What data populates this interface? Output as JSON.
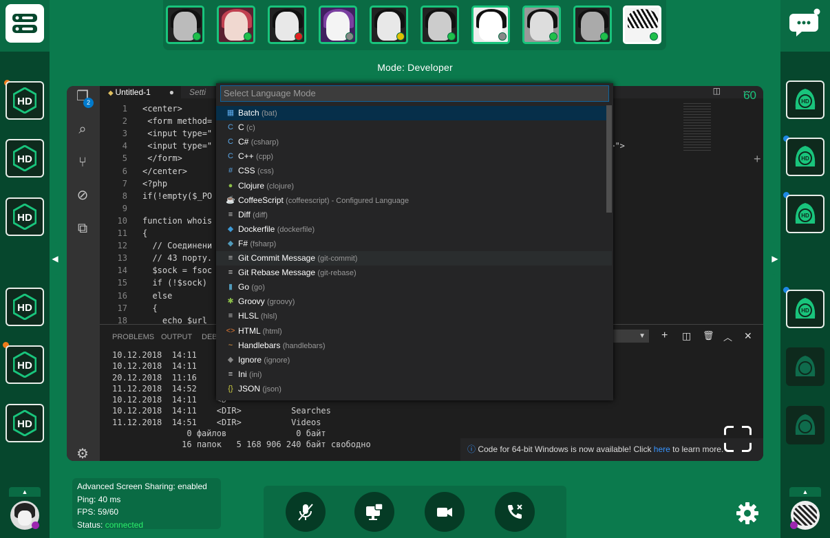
{
  "colors": {
    "accent": "#19c47c",
    "panel": "#0a6b44",
    "sidebar": "#06472d"
  },
  "mode_label": "Mode: Developer",
  "participants": [
    {
      "status": "#1fbf4a"
    },
    {
      "status": "#1fbf4a"
    },
    {
      "status": "#e02020"
    },
    {
      "status": "#888888"
    },
    {
      "status": "#e0c000"
    },
    {
      "status": "#1fbf4a"
    },
    {
      "status": "#888888"
    },
    {
      "status": "#1fbf4a"
    },
    {
      "status": "#1fbf4a"
    },
    {
      "status": "#1fbf4a"
    }
  ],
  "editor": {
    "tab_active": "Untitled-1",
    "tab_other": "Setti",
    "explorer_badge": "2",
    "fps_overlay": "60",
    "code_lines": [
      {
        "n": "1",
        "t": "<center>"
      },
      {
        "n": "2",
        "t": " <form method="
      },
      {
        "n": "3",
        "t": " <input type=\""
      },
      {
        "n": "4",
        "t": " <input type=\""
      },
      {
        "n": "5",
        "t": " </form>"
      },
      {
        "n": "6",
        "t": "</center>"
      },
      {
        "n": "7",
        "t": "<?php"
      },
      {
        "n": "8",
        "t": "if(!empty($_PO"
      },
      {
        "n": "9",
        "t": ""
      },
      {
        "n": "10",
        "t": "function whois"
      },
      {
        "n": "11",
        "t": "{"
      },
      {
        "n": "12",
        "t": "  // Соединени"
      },
      {
        "n": "13",
        "t": "  // 43 порту."
      },
      {
        "n": "14",
        "t": "  $sock = fsoc"
      },
      {
        "n": "15",
        "t": "  if (!$sock)"
      },
      {
        "n": "16",
        "t": "  else"
      },
      {
        "n": "17",
        "t": "  {"
      },
      {
        "n": "18",
        "t": "    echo $url"
      }
    ],
    "code_right_fragment": "?>\">",
    "language_picker": {
      "placeholder": "Select Language Mode",
      "items": [
        {
          "icon": "▦",
          "name": "Batch",
          "id": "(bat)"
        },
        {
          "icon": "C",
          "name": "C",
          "id": "(c)"
        },
        {
          "icon": "C",
          "name": "C#",
          "id": "(csharp)"
        },
        {
          "icon": "C",
          "name": "C++",
          "id": "(cpp)"
        },
        {
          "icon": "#",
          "name": "CSS",
          "id": "(css)"
        },
        {
          "icon": "●",
          "name": "Clojure",
          "id": "(clojure)"
        },
        {
          "icon": "☕",
          "name": "CoffeeScript",
          "id": "(coffeescript) - Configured Language"
        },
        {
          "icon": "≡",
          "name": "Diff",
          "id": "(diff)"
        },
        {
          "icon": "◆",
          "name": "Dockerfile",
          "id": "(dockerfile)"
        },
        {
          "icon": "◆",
          "name": "F#",
          "id": "(fsharp)"
        },
        {
          "icon": "≡",
          "name": "Git Commit Message",
          "id": "(git-commit)"
        },
        {
          "icon": "≡",
          "name": "Git Rebase Message",
          "id": "(git-rebase)"
        },
        {
          "icon": "▮",
          "name": "Go",
          "id": "(go)"
        },
        {
          "icon": "✱",
          "name": "Groovy",
          "id": "(groovy)"
        },
        {
          "icon": "≡",
          "name": "HLSL",
          "id": "(hlsl)"
        },
        {
          "icon": "<>",
          "name": "HTML",
          "id": "(html)"
        },
        {
          "icon": "~",
          "name": "Handlebars",
          "id": "(handlebars)"
        },
        {
          "icon": "◆",
          "name": "Ignore",
          "id": "(ignore)"
        },
        {
          "icon": "≡",
          "name": "Ini",
          "id": "(ini)"
        },
        {
          "icon": "{}",
          "name": "JSON",
          "id": "(json)"
        }
      ]
    },
    "panel_tabs": [
      "PROBLEMS",
      "OUTPUT",
      "DEBU"
    ],
    "terminal_lines": [
      "10.12.2018  14:11    <D",
      "10.12.2018  14:11    <D",
      "20.12.2018  11:16    <D",
      "11.12.2018  14:52    <D",
      "10.12.2018  14:11    <D",
      "10.12.2018  14:11    <DIR>          Searches",
      "11.12.2018  14:51    <DIR>          Videos",
      "               0 файлов              0 байт",
      "              16 папок   5 168 906 240 байт свободно"
    ],
    "notification_text": "Code for 64-bit Windows is now available! Click ",
    "notification_link": "here",
    "notification_tail": " to learn more."
  },
  "stats": {
    "line1": "Advanced Screen Sharing: enabled",
    "line2": "Ping: 40 ms",
    "line3": "FPS: 59/60",
    "status_label": "Status: ",
    "status_value": "connected"
  }
}
